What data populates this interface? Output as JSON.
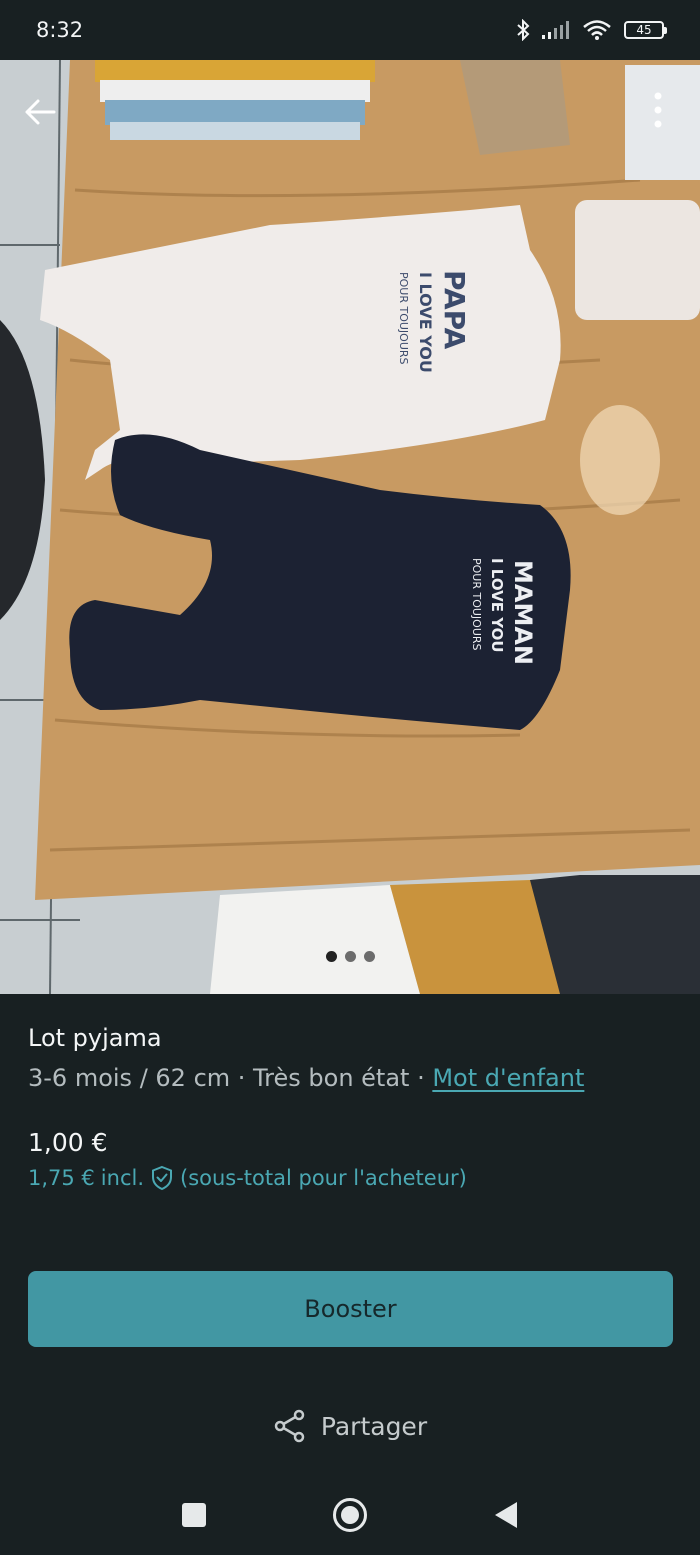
{
  "status_bar": {
    "time": "8:32",
    "battery": "45",
    "icons": [
      "bluetooth-icon",
      "signal-icon",
      "wifi-icon",
      "battery-icon"
    ]
  },
  "gallery": {
    "total_images": 3,
    "active_index": 0
  },
  "listing": {
    "title": "Lot pyjama",
    "meta_prefix": "3-6 mois / 62 cm · Très bon état · ",
    "brand": "Mot d'enfant",
    "price": "1,00 €",
    "total_price": "1,75 €",
    "total_incl": "incl.",
    "total_note": "(sous-total pour l'acheteur)"
  },
  "actions": {
    "booster_label": "Booster",
    "share_label": "Partager"
  },
  "colors": {
    "background": "#182022",
    "accent": "#4297a3",
    "link": "#4aa8b3"
  }
}
